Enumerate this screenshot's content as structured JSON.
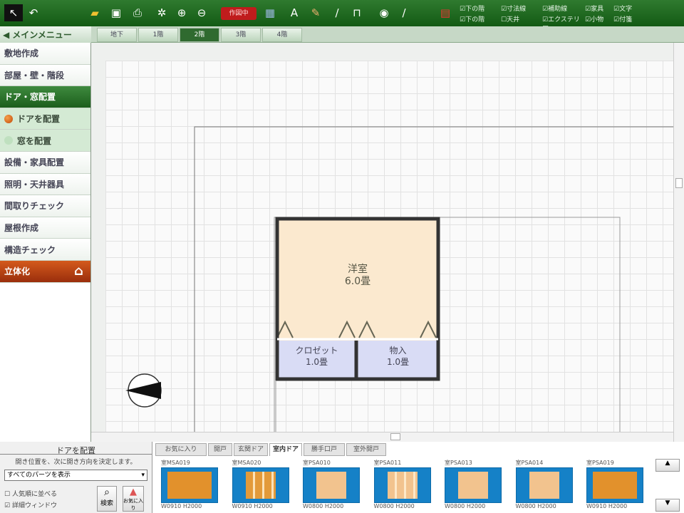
{
  "toolbar": {
    "mode_button": "作図中",
    "icons": [
      "select-arrow-icon",
      "undo-icon",
      "open-folder-icon",
      "save-icon",
      "print-icon",
      "settings-icon",
      "zoom-in-icon",
      "zoom-out-icon",
      "calculator-icon",
      "text-icon",
      "paint-icon",
      "pen-icon",
      "wall-icon",
      "compass-icon",
      "measure-icon",
      "display-icon"
    ],
    "checkboxes": [
      {
        "label": "下の階",
        "checked": true
      },
      {
        "label": "寸法線",
        "checked": true
      },
      {
        "label": "補助線",
        "checked": true
      },
      {
        "label": "家具",
        "checked": true
      },
      {
        "label": "文字",
        "checked": true
      },
      {
        "label": "下の階",
        "checked": true
      },
      {
        "label": "天井",
        "checked": false
      },
      {
        "label": "エクステリア",
        "checked": true
      },
      {
        "label": "小物",
        "checked": true
      },
      {
        "label": "付箋",
        "checked": true
      }
    ]
  },
  "main_menu": "メインメニュー",
  "floor_tabs": [
    {
      "label": "地下"
    },
    {
      "label": "1階"
    },
    {
      "label": "2階",
      "active": true
    },
    {
      "label": "3階"
    },
    {
      "label": "4階"
    }
  ],
  "sidebar": {
    "items": [
      {
        "label": "敷地作成"
      },
      {
        "label": "部屋・壁・階段"
      },
      {
        "label": "ドア・窓配置",
        "type": "head"
      },
      {
        "label": "ドアを配置",
        "type": "sub",
        "selected": true
      },
      {
        "label": "窓を配置",
        "type": "sub"
      },
      {
        "label": "設備・家具配置"
      },
      {
        "label": "照明・天井器具"
      },
      {
        "label": "間取りチェック"
      },
      {
        "label": "屋根作成"
      },
      {
        "label": "構造チェック"
      },
      {
        "label": "立体化",
        "type": "red"
      }
    ]
  },
  "plan": {
    "rooms": [
      {
        "name": "洋室",
        "size": "6.0畳"
      },
      {
        "name": "クロゼット",
        "size": "1.0畳"
      },
      {
        "name": "物入",
        "size": "1.0畳"
      }
    ]
  },
  "panel": {
    "title": "ドアを配置",
    "instruction": "開き位置を、次に開き方向を決定します。",
    "filter": "すべてのパーツを表示",
    "check_popular": {
      "label": "人気順に並べる",
      "checked": false
    },
    "check_detail": {
      "label": "詳細ウィンドウ",
      "checked": true
    },
    "search_button": "検索",
    "favorite_button": "お気に入り"
  },
  "part_tabs": [
    {
      "label": "お気に入り"
    },
    {
      "label": "開戸"
    },
    {
      "label": "玄関ドア"
    },
    {
      "label": "室内ドア",
      "active": true
    },
    {
      "label": "勝手口戸"
    },
    {
      "label": "室外開戸"
    }
  ],
  "parts": [
    {
      "code": "室MSA019",
      "size": "W0910 H2000",
      "style": "wide"
    },
    {
      "code": "室MSA020",
      "size": "W0910 H2000",
      "style": "lines"
    },
    {
      "code": "室PSA010",
      "size": "W0800 H2000",
      "style": "plain"
    },
    {
      "code": "室PSA011",
      "size": "W0800 H2000",
      "style": "lines"
    },
    {
      "code": "室PSA013",
      "size": "W0800 H2000",
      "style": "plain"
    },
    {
      "code": "室PSA014",
      "size": "W0800 H2000",
      "style": "plain"
    },
    {
      "code": "室PSA019",
      "size": "W0910 H2000",
      "style": "wide"
    }
  ]
}
